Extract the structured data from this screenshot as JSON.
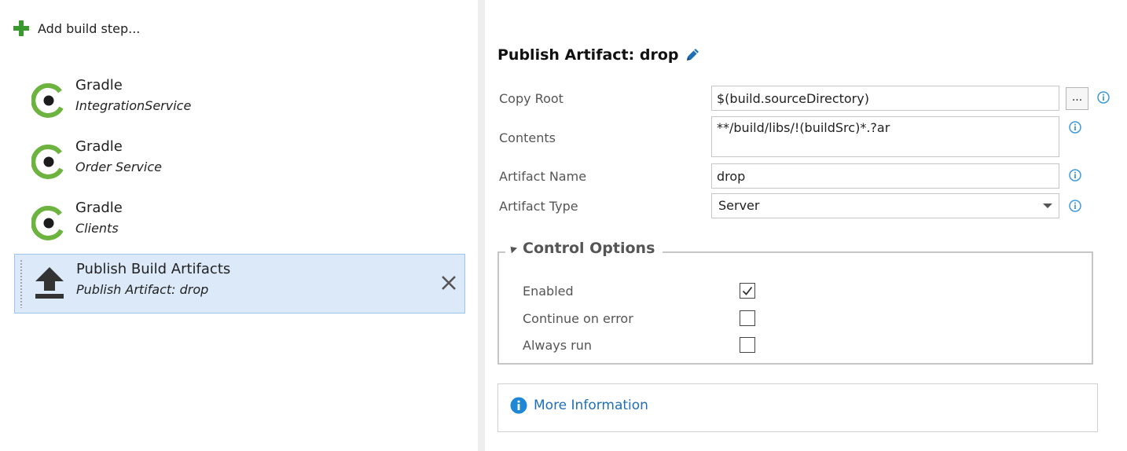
{
  "left_panel": {
    "add_step_label": "Add build step...",
    "steps": [
      {
        "title": "Gradle",
        "subtitle": "IntegrationService",
        "icon": "gradle-icon"
      },
      {
        "title": "Gradle",
        "subtitle": "Order Service",
        "icon": "gradle-icon"
      },
      {
        "title": "Gradle",
        "subtitle": "Clients",
        "icon": "gradle-icon"
      },
      {
        "title": "Publish Build Artifacts",
        "subtitle": "Publish Artifact: drop",
        "icon": "upload-icon",
        "selected": true
      }
    ]
  },
  "task": {
    "title": "Publish Artifact: drop",
    "fields": {
      "copy_root": {
        "label": "Copy Root",
        "value": "$(build.sourceDirectory)",
        "browse_label": "..."
      },
      "contents": {
        "label": "Contents",
        "value": "**/build/libs/!(buildSrc)*.?ar"
      },
      "artifact_name": {
        "label": "Artifact Name",
        "value": "drop"
      },
      "artifact_type": {
        "label": "Artifact Type",
        "value": "Server"
      }
    }
  },
  "control_options": {
    "title": "Control Options",
    "options": [
      {
        "label": "Enabled",
        "checked": true
      },
      {
        "label": "Continue on error",
        "checked": false
      },
      {
        "label": "Always run",
        "checked": false
      }
    ]
  },
  "more_info": {
    "label": "More Information"
  },
  "colors": {
    "accent_green": "#3a9a2e",
    "gradle_green": "#6db33f",
    "selection_bg": "#dbe9f9",
    "info_blue": "#3f9ad8",
    "link_blue": "#1e6fb8"
  }
}
